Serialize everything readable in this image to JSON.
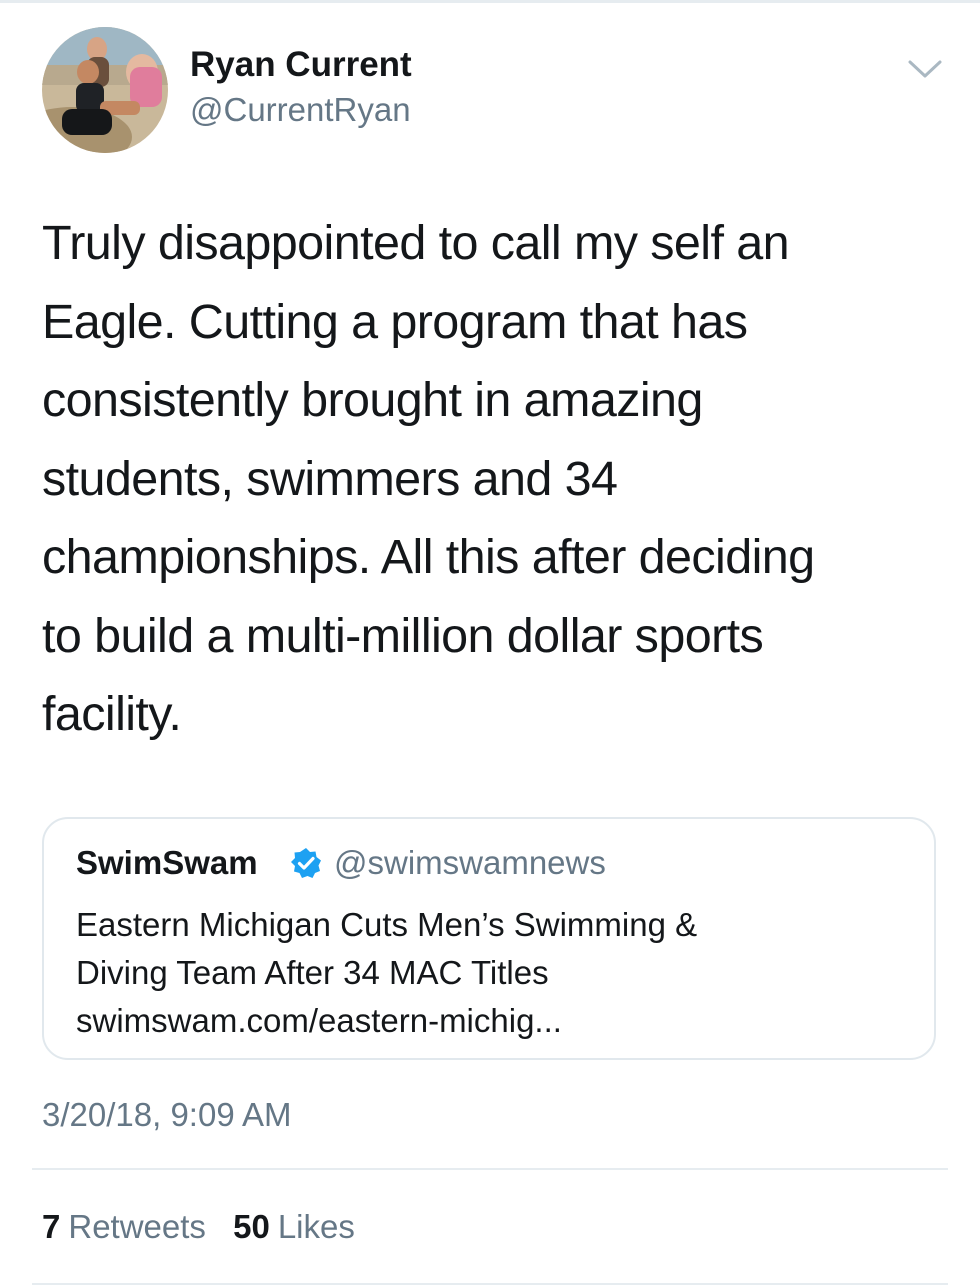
{
  "author": {
    "display_name": "Ryan Current",
    "handle": "@CurrentRyan",
    "avatar_icon": "beach-photo-avatar"
  },
  "tweet": {
    "text_lines": [
      "Truly disappointed to call my self an",
      "Eagle. Cutting a program that has",
      "consistently brought in amazing",
      "students, swimmers and 34",
      "championships. All this after deciding",
      "to build a multi-million dollar sports",
      "facility."
    ],
    "timestamp": "3/20/18, 9:09 AM"
  },
  "quote": {
    "name": "SwimSwam",
    "verified": true,
    "handle": "@swimswamnews",
    "lines": [
      "Eastern Michigan Cuts Men’s Swimming &",
      "Diving Team After 34 MAC Titles",
      "swimswam.com/eastern-michig..."
    ]
  },
  "stats": {
    "retweets_count": "7",
    "retweets_label": "Retweets",
    "likes_count": "50",
    "likes_label": "Likes"
  },
  "colors": {
    "text_primary": "#14171a",
    "text_secondary": "#657786",
    "verified_blue": "#1da1f2",
    "border": "#e1e8ed"
  }
}
